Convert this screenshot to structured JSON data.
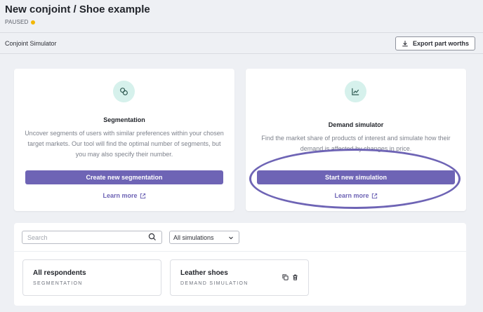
{
  "header": {
    "title": "New conjoint / Shoe example",
    "status": "PAUSED",
    "status_color": "#f2b705"
  },
  "toolbar": {
    "label": "Conjoint Simulator",
    "export_label": "Export part worths",
    "export_icon": "download-icon"
  },
  "cards": {
    "segmentation": {
      "icon": "segments-icon",
      "title": "Segmentation",
      "description": "Uncover segments of users with similar preferences within your chosen target markets. Our tool will find the optimal number of segments, but you may also specify their number.",
      "button": "Create new segmentation",
      "learn_more": "Learn more"
    },
    "demand": {
      "icon": "chart-trend-icon",
      "title": "Demand simulator",
      "description": "Find the market share of products of interest and simulate how their demand is affected by changes in price.",
      "button": "Start new simulation",
      "learn_more": "Learn more"
    }
  },
  "filters": {
    "search_placeholder": "Search",
    "search_value": "",
    "select_value": "All simulations"
  },
  "simulations": [
    {
      "name": "All respondents",
      "type": "SEGMENTATION"
    },
    {
      "name": "Leather shoes",
      "type": "DEMAND SIMULATION"
    }
  ],
  "colors": {
    "accent": "#6e64b5",
    "icon_bg": "#d6f1ec",
    "icon_fg": "#2f5a52",
    "background": "#eef0f4"
  }
}
